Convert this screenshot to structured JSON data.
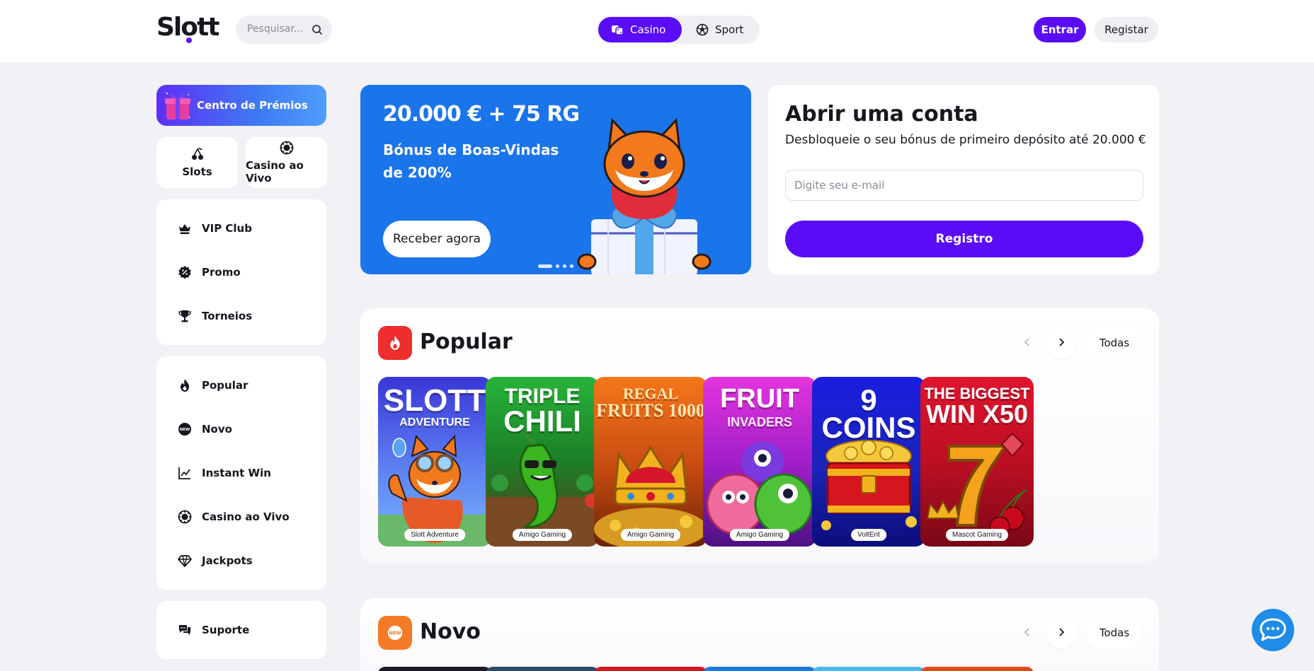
{
  "header": {
    "logo": "Slott",
    "search_placeholder": "Pesquisar...",
    "toggle": {
      "casino": "Casino",
      "sport": "Sport",
      "active": "casino"
    },
    "login": "Entrar",
    "register": "Registar"
  },
  "sidebar": {
    "prize_center": "Centro de Prémios",
    "quick": [
      {
        "label": "Slots",
        "icon": "cherry-icon"
      },
      {
        "label": "Casino ao Vivo",
        "icon": "chip-icon"
      }
    ],
    "group1": [
      {
        "label": "VIP Club",
        "icon": "crown-icon"
      },
      {
        "label": "Promo",
        "icon": "percent-icon"
      },
      {
        "label": "Torneios",
        "icon": "trophy-icon"
      }
    ],
    "group2": [
      {
        "label": "Popular",
        "icon": "fire-icon"
      },
      {
        "label": "Novo",
        "icon": "new-badge-icon"
      },
      {
        "label": "Instant Win",
        "icon": "chart-icon"
      },
      {
        "label": "Casino ao Vivo",
        "icon": "chip-icon"
      },
      {
        "label": "Jackpots",
        "icon": "diamond-icon"
      }
    ],
    "support": "Suporte"
  },
  "banner": {
    "title": "20.000 € + 75 RG",
    "subtitle": "Bónus de Boas-Vindas de 200%",
    "cta": "Receber agora",
    "slides": 4,
    "active_slide": 1
  },
  "register": {
    "title": "Abrir uma conta",
    "subtitle": "Desbloqueie o seu bónus de primeiro depósito até 20.000 €",
    "email_placeholder": "Digite seu e-mail",
    "button": "Registro"
  },
  "sections": {
    "popular": {
      "title": "Popular",
      "all": "Todas",
      "games": [
        {
          "name": "SLOTT",
          "sub": "ADVENTURE",
          "provider": "Slott Adventure",
          "colors": [
            "#3a36d8",
            "#7ab6ff"
          ]
        },
        {
          "name": "TRIPLE",
          "sub": "CHILI",
          "provider": "Amigo Gaming",
          "colors": [
            "#1f9a2c",
            "#0f4f12"
          ]
        },
        {
          "name": "REGAL",
          "sub": "FRUITS 1000",
          "provider": "Amigo Gaming",
          "colors": [
            "#f5771a",
            "#8a2c08"
          ]
        },
        {
          "name": "FRUIT",
          "sub": "INVADERS",
          "provider": "Amigo Gaming",
          "colors": [
            "#e12fd8",
            "#5a1390"
          ]
        },
        {
          "name": "9 COINS",
          "sub": "",
          "provider": "VoltEnt",
          "colors": [
            "#1a1ee0",
            "#0c0d7a"
          ]
        },
        {
          "name": "THE BIGGEST",
          "sub": "WIN X50",
          "provider": "Mascot Gaming",
          "colors": [
            "#d8102a",
            "#7a0816"
          ]
        }
      ]
    },
    "novo": {
      "title": "Novo",
      "all": "Todas"
    }
  },
  "colors": {
    "brand": "#5a0cf6",
    "banner": "#1a74ea",
    "popular_icon": "#ef2d2d",
    "novo_icon": "#f57a26"
  }
}
